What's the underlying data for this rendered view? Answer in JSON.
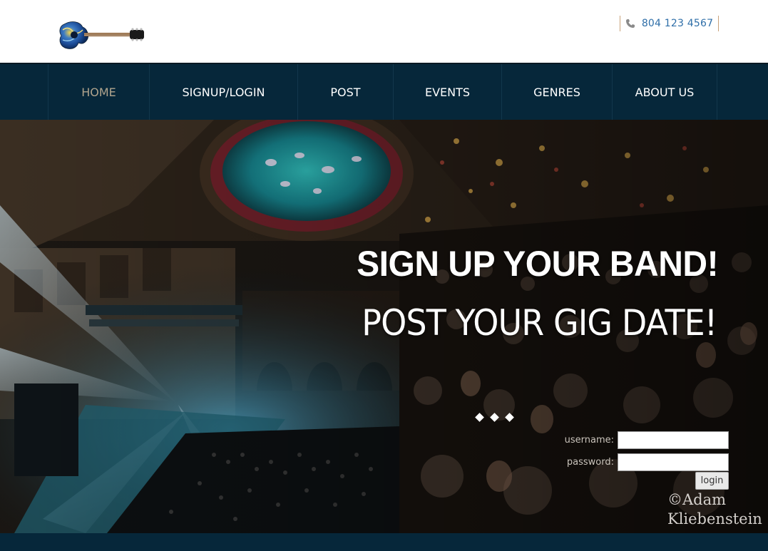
{
  "header": {
    "logo_name": "guitar-logo",
    "phone_icon": "phone-icon",
    "phone": "804 123 4567"
  },
  "nav": {
    "items": [
      {
        "label": "HOME",
        "active": true
      },
      {
        "label": "SIGNUP/LOGIN"
      },
      {
        "label": "POST"
      },
      {
        "label": "EVENTS"
      },
      {
        "label": "GENRES"
      },
      {
        "label": "ABOUT US"
      }
    ]
  },
  "hero": {
    "headline": "SIGN UP YOUR BAND!",
    "subline": "POST YOUR GIG DATE!",
    "slide_count": 3,
    "watermark_line1": "©Adam",
    "watermark_line2": "Kliebenstein"
  },
  "login": {
    "username_label": "username:",
    "password_label": "password:",
    "username_value": "",
    "password_value": "",
    "button_label": "login"
  },
  "colors": {
    "nav_bg": "#06273a",
    "nav_active": "#b0a48d",
    "phone_text": "#2e6ea8",
    "phone_border": "#c9a27a"
  }
}
